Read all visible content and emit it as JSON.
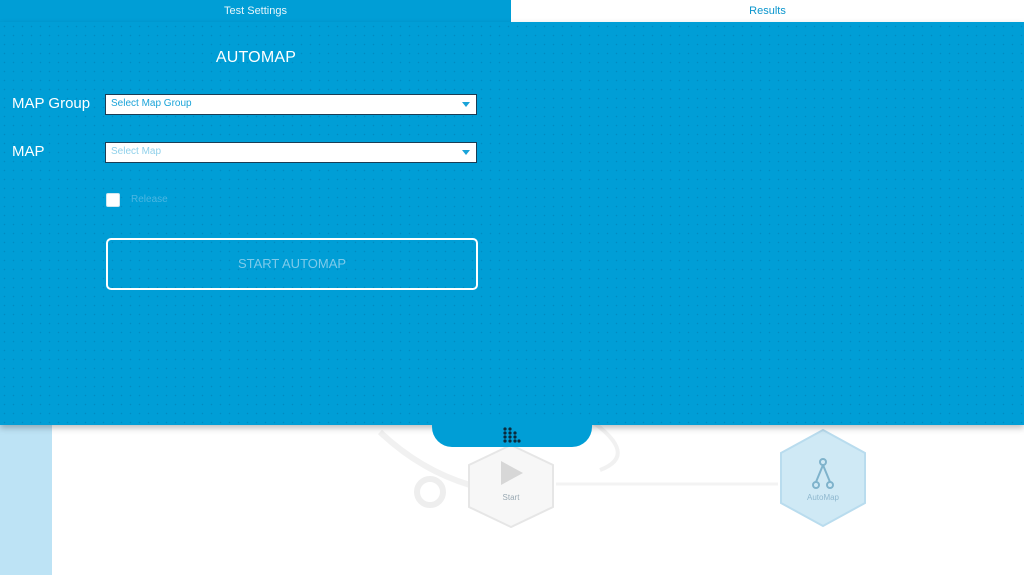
{
  "tabs": {
    "test_settings": "Test Settings",
    "results": "Results"
  },
  "panel": {
    "title": "AUTOMAP",
    "map_group": {
      "label": "MAP Group",
      "value": "Select Map Group"
    },
    "map": {
      "label": "MAP",
      "value": "Select Map"
    },
    "release": {
      "label": "Release",
      "checked": false
    },
    "start_button": "START AUTOMAP"
  },
  "handle": {
    "icon": "grid-dots-icon"
  },
  "background": {
    "nodes": [
      {
        "label": "Start",
        "icon": "play-icon"
      },
      {
        "label": "AutoMap",
        "icon": "route-icon"
      }
    ]
  },
  "colors": {
    "panel_blue": "#009ed6",
    "tab_active_text": "#e7f5fb",
    "tab_inactive_text": "#0a95cd",
    "select_text": "#1aa3d8"
  }
}
